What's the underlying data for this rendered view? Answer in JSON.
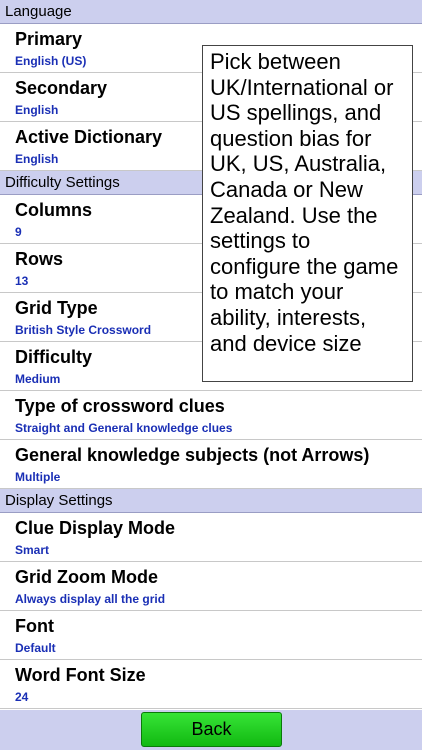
{
  "sections": [
    {
      "header": "Language",
      "rows": [
        {
          "title": "Primary",
          "value": "English (US)"
        },
        {
          "title": "Secondary",
          "value": "English"
        },
        {
          "title": "Active Dictionary",
          "value": "English"
        }
      ]
    },
    {
      "header": "Difficulty Settings",
      "rows": [
        {
          "title": "Columns",
          "value": "9"
        },
        {
          "title": "Rows",
          "value": "13"
        },
        {
          "title": "Grid Type",
          "value": "British Style Crossword"
        },
        {
          "title": "Difficulty",
          "value": "Medium"
        },
        {
          "title": "Type of crossword clues",
          "value": "Straight and General knowledge clues"
        },
        {
          "title": "General knowledge subjects (not Arrows)",
          "value": "Multiple"
        }
      ]
    },
    {
      "header": "Display Settings",
      "rows": [
        {
          "title": "Clue Display Mode",
          "value": "Smart"
        },
        {
          "title": "Grid Zoom Mode",
          "value": "Always display all the grid"
        },
        {
          "title": "Font",
          "value": "Default"
        },
        {
          "title": "Word Font Size",
          "value": "24"
        }
      ]
    }
  ],
  "tooltip": {
    "text": "Pick between UK/International or US spellings, and question bias for UK, US, Australia, Canada or New Zealand. Use the settings to configure the game to match your ability, interests, and device size"
  },
  "footer": {
    "back_label": "Back"
  },
  "colors": {
    "section_header_bg": "#cccfee",
    "value_text": "#1a2fb5",
    "back_button": "#22cc22"
  }
}
